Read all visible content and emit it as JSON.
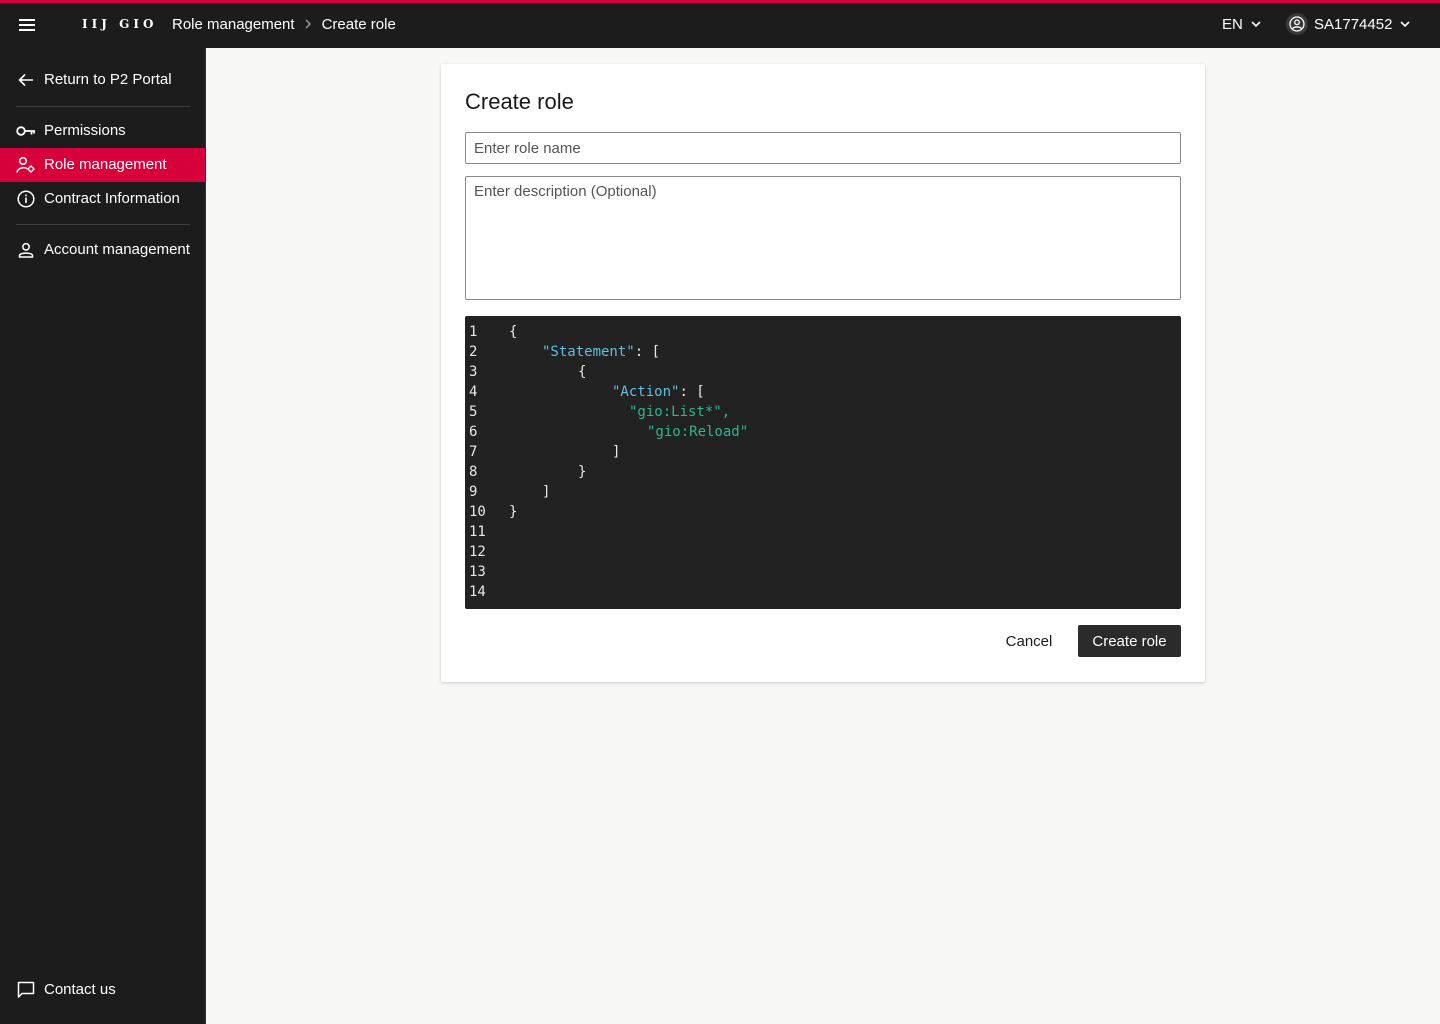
{
  "header": {
    "logo_text": "IIJ GIO",
    "breadcrumb": [
      "Role management",
      "Create role"
    ],
    "language": "EN",
    "user_id": "SA1774452"
  },
  "sidebar": {
    "return_label": "Return to P2 Portal",
    "items": [
      {
        "label": "Permissions",
        "icon": "key-icon",
        "active": false
      },
      {
        "label": "Role management",
        "icon": "role-settings-icon",
        "active": true
      },
      {
        "label": "Contract Information",
        "icon": "info-icon",
        "active": false
      },
      {
        "label": "Account management",
        "icon": "person-icon",
        "active": false
      }
    ],
    "contact_label": "Contact us"
  },
  "form": {
    "title": "Create role",
    "name_placeholder": "Enter role name",
    "name_value": "",
    "description_placeholder": "Enter description (Optional)",
    "description_value": "",
    "cancel_label": "Cancel",
    "submit_label": "Create role"
  },
  "editor": {
    "line_numbers": [
      "1",
      "2",
      "3",
      "4",
      "5",
      "6",
      "7",
      "8",
      "9",
      "10",
      "11",
      "12",
      "13",
      "14"
    ],
    "lines": [
      [
        {
          "t": "{",
          "k": "pun"
        }
      ],
      [
        {
          "t": "\"Statement\"",
          "k": "key"
        },
        {
          "t": ": [",
          "k": "pun"
        }
      ],
      [
        {
          "t": "{",
          "k": "pun"
        }
      ],
      [
        {
          "t": "\"Action\"",
          "k": "key"
        },
        {
          "t": ": [",
          "k": "pun"
        }
      ],
      [
        {
          "t": "\"gio:List*\",",
          "k": "str"
        }
      ],
      [
        {
          "t": "\"gio:Reload\"",
          "k": "str"
        }
      ],
      [
        {
          "t": "]",
          "k": "pun"
        }
      ],
      [
        {
          "t": "}",
          "k": "pun"
        }
      ],
      [
        {
          "t": "]",
          "k": "pun"
        }
      ],
      [
        {
          "t": "}",
          "k": "pun"
        }
      ],
      [],
      [],
      [],
      []
    ]
  },
  "colors": {
    "accent": "#d7003a",
    "topbar": "#1c1c1c",
    "editor_bg": "#222222",
    "json_key": "#5fc0dd",
    "json_string": "#2bb596"
  }
}
